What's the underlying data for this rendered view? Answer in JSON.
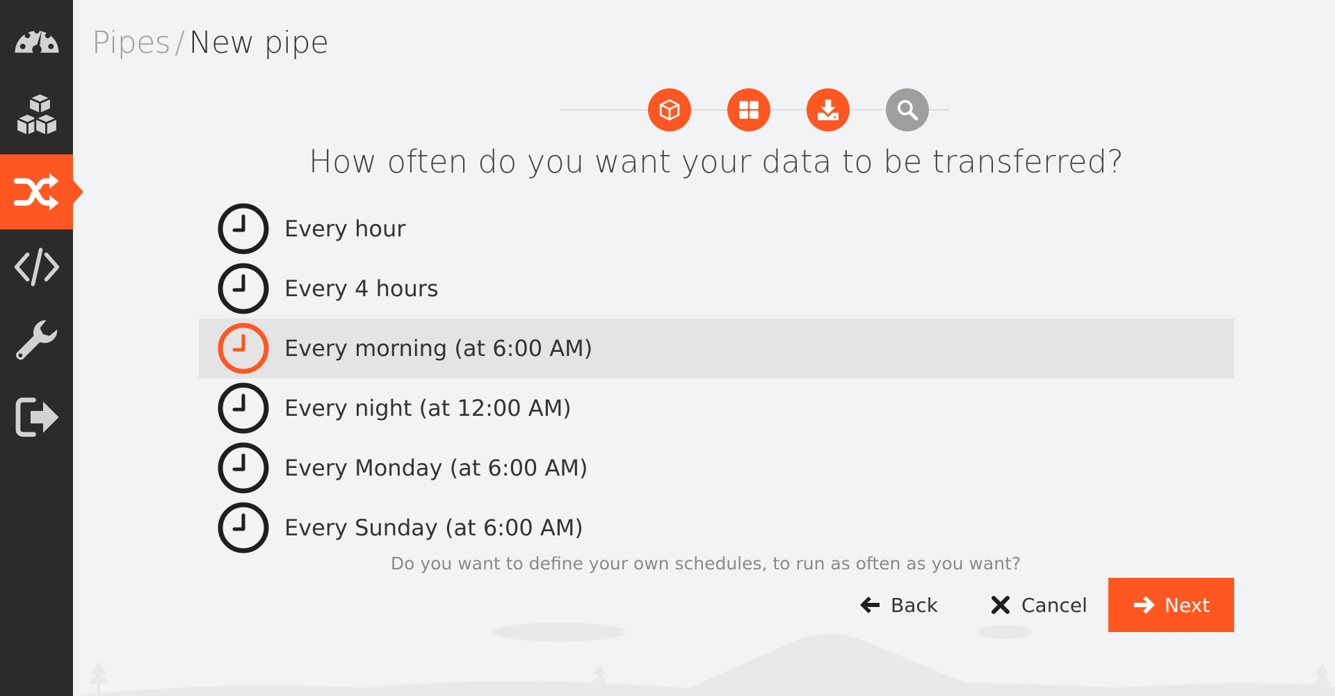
{
  "sidebar": {
    "items": [
      {
        "icon": "dashboard-icon",
        "active": false
      },
      {
        "icon": "cubes-icon",
        "active": false
      },
      {
        "icon": "shuffle-icon",
        "active": true
      },
      {
        "icon": "code-icon",
        "active": false
      },
      {
        "icon": "wrench-icon",
        "active": false
      },
      {
        "icon": "sign-out-icon",
        "active": false
      }
    ]
  },
  "breadcrumb": {
    "root": "Pipes",
    "separator": "/",
    "current": "New pipe"
  },
  "steps": [
    {
      "icon": "cube-icon",
      "state": "done",
      "color": "#fe5722"
    },
    {
      "icon": "grid-icon",
      "state": "done",
      "color": "#fe5722"
    },
    {
      "icon": "download-icon",
      "state": "current",
      "color": "#fe5722"
    },
    {
      "icon": "search-icon",
      "state": "pending",
      "color": "#9e9e9e"
    }
  ],
  "question": "How often do you want your data to be transferred?",
  "options": [
    {
      "label": "Every hour",
      "selected": false
    },
    {
      "label": "Every 4 hours",
      "selected": false
    },
    {
      "label": "Every morning (at 6:00 AM)",
      "selected": true
    },
    {
      "label": "Every night (at 12:00 AM)",
      "selected": false
    },
    {
      "label": "Every Monday (at 6:00 AM)",
      "selected": false
    },
    {
      "label": "Every Sunday (at 6:00 AM)",
      "selected": false
    }
  ],
  "custom_schedule_link": "Do you want to define your own schedules, to run as often as you want?",
  "actions": {
    "back_label": "Back",
    "cancel_label": "Cancel",
    "next_label": "Next"
  },
  "colors": {
    "accent": "#fe5722",
    "sidebar_bg": "#2b2b2b",
    "page_bg": "#f2f3f4",
    "selected_row": "#e4e4e4"
  }
}
